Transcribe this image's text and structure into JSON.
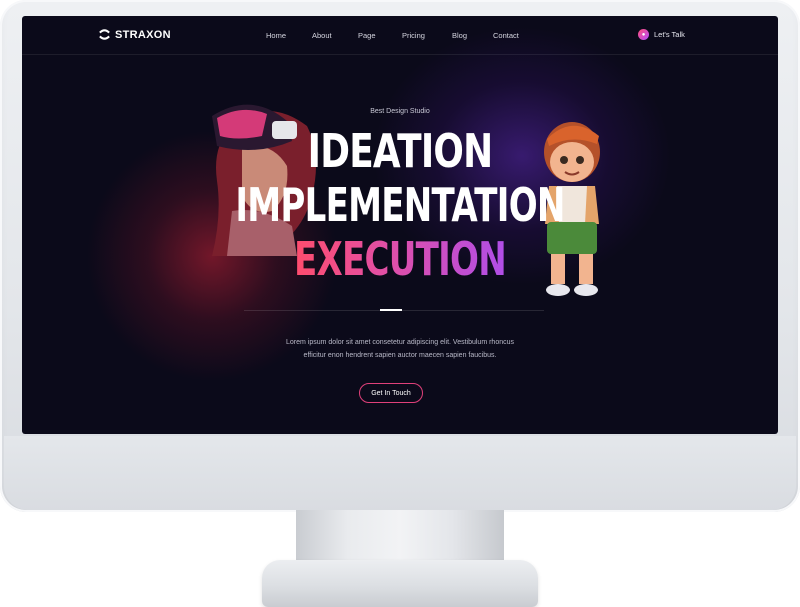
{
  "nav": {
    "logo_text": "STRAXON",
    "items": [
      "Home",
      "About",
      "Page",
      "Pricing",
      "Blog",
      "Contact"
    ],
    "cta_label": "Let's Talk"
  },
  "hero": {
    "eyebrow": "Best Design Studio",
    "line1": "IDEATION",
    "line2": "IMPLEMENTATION",
    "line3": "EXECUTION",
    "description_1": "Lorem ipsum dolor sit amet consetetur adipiscing elit. Vestibulum rhoncus",
    "description_2": "efficitur enon hendrent sapien auctor maecen sapien faucibus.",
    "button_label": "Get In Touch"
  },
  "colors": {
    "background": "#0b0a1a",
    "accent_pink": "#e0407a",
    "accent_purple": "#b04ee8",
    "frame": "#e3e6ea"
  },
  "icons": {
    "logo": "swirl-logo-icon",
    "cta": "pink-dot-icon"
  }
}
